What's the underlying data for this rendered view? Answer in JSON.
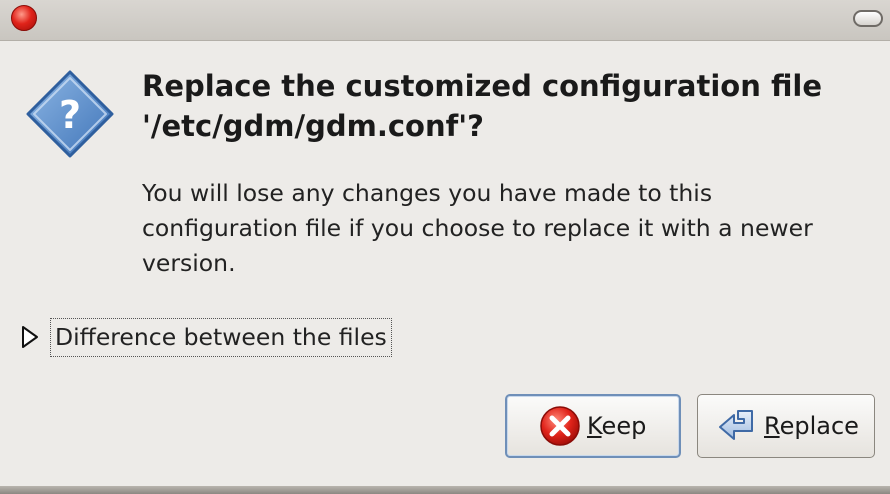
{
  "window": {
    "close_icon": "close-circle-icon",
    "shade_icon": "window-shade-icon"
  },
  "dialog": {
    "icon": "question-diamond-icon",
    "headline_line1": "Replace the customized configuration file",
    "headline_line2": "'/etc/gdm/gdm.conf'?",
    "body_line1": "You will lose any changes you have made to this",
    "body_line2": "configuration file if you choose to replace it with a newer",
    "body_line3": "version."
  },
  "expander": {
    "label": "Difference between the files",
    "expanded": false,
    "icon": "triangle-right-icon"
  },
  "buttons": {
    "keep": {
      "mnemonic": "K",
      "rest": "eep",
      "icon": "cancel-icon"
    },
    "replace": {
      "mnemonic": "R",
      "rest": "eplace",
      "icon": "replace-arrow-icon"
    }
  },
  "colors": {
    "dialog_bg": "#edebe8",
    "titlebar": "#d0cdc8",
    "close_red": "#e0231a",
    "icon_blue": "#5a8cc8",
    "focus_border": "#6f8fb8"
  }
}
